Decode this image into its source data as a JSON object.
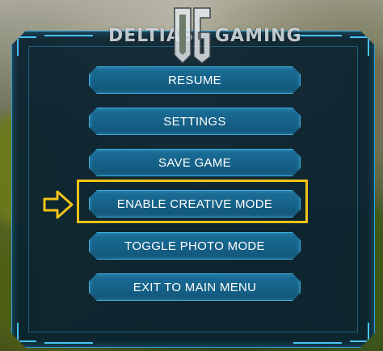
{
  "watermark": {
    "left_text": "DELTIAS",
    "logo_text": "DG",
    "right_text": "GAMING"
  },
  "menu": {
    "items": [
      {
        "label": "RESUME"
      },
      {
        "label": "SETTINGS"
      },
      {
        "label": "SAVE GAME"
      },
      {
        "label": "ENABLE CREATIVE MODE",
        "highlighted": true
      },
      {
        "label": "TOGGLE PHOTO MODE"
      },
      {
        "label": "EXIT TO MAIN MENU"
      }
    ]
  },
  "colors": {
    "panel_border": "#2f9fd6",
    "button_fill": "#1a6f99",
    "highlight": "#f2c417"
  },
  "icons": {
    "pointer": "arrow-right-outline-icon"
  }
}
